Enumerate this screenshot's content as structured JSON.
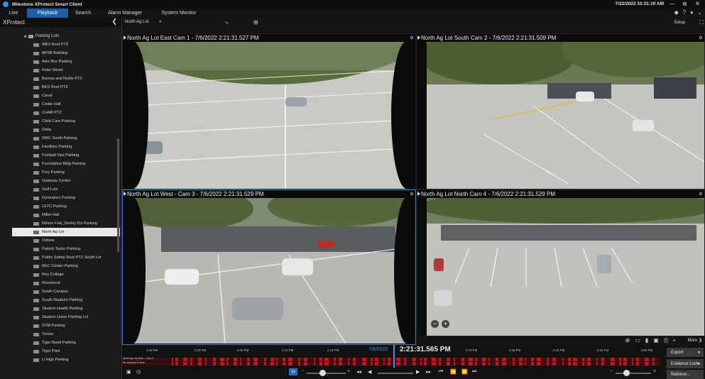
{
  "window": {
    "title": "Milestone XProtect Smart Client",
    "clock": "7/22/2022 10:21:10 AM",
    "buttons": [
      "—",
      "⧉",
      "✕"
    ]
  },
  "menu": {
    "tabs": [
      "Live",
      "Playback",
      "Search",
      "Alarm Manager",
      "System Monitor"
    ],
    "active": "Playback"
  },
  "sidebar": {
    "title": "XProtect",
    "group": "Parking Lots",
    "items": [
      "ABO Roof PTZ",
      "AFSB Building",
      "Alex Box Parking",
      "Aster Street",
      "Barnes and Noble PTZ",
      "BES Roof PTZ",
      "Canal",
      "Cedar Hall",
      "CHAB PTZ",
      "Child Care Parking",
      "Delta",
      "DMC South Parking",
      "Facilities Parking",
      "Football Ops Parking",
      "Foundation Bldg Parking",
      "Frey Parking",
      "Gateway Center",
      "Gulf Lots",
      "Gymnatics Parking",
      "LETC Parking",
      "Miller Hall",
      "Minnie Fisk_Dorthy Dix Parking",
      "North Ag Lot",
      "Oxbow",
      "Patrick Taylor Parking",
      "Public Safety Roof PTZ South Lot",
      "REC Center Parking",
      "Res College",
      "Riverbend",
      "South Campus",
      "South Stadium Parking",
      "Student Health Parking",
      "Student Union Parking Lot",
      "SVM Parking",
      "Tennis",
      "Tiger Band Parking",
      "Tiger Park",
      "U High Parking"
    ],
    "selected": "North Ag Lot"
  },
  "viewbar": {
    "view_name": "North Ag Lot",
    "setup": "Setup"
  },
  "cameras": [
    {
      "title": "North Ag Lot East Cam 1 - 7/6/2022 2:21:31.527 PM"
    },
    {
      "title": "North Ag Lot South Cam 2 - 7/6/2022 2:21:31.509 PM"
    },
    {
      "title": "North Ag Lot West - Cam 3 - 7/6/2022 2:21:31.529 PM"
    },
    {
      "title": "North Ag Lot North Cam 4 - 7/6/2022 2:21:31.529 PM"
    }
  ],
  "camera_toolbar": {
    "more": "More"
  },
  "timeline": {
    "ticks": [
      "1:55 PM",
      "2:00 PM",
      "2:05 PM",
      "2:10 PM",
      "2:15 PM",
      "2:30 PM",
      "2:35 PM",
      "2:40 PM",
      "2:45 PM",
      "2:50 PM"
    ],
    "date": "7/6/2022",
    "current_time": "2:21:31.565 PM",
    "track1_label": "North Ag Lot West - Cam 3",
    "track2_label": "All cameras in view",
    "speed_badge": "1x"
  },
  "actions": {
    "export": "Export",
    "evidence_lock": "Evidence Lock",
    "retrieve": "Retrieve..."
  },
  "colors": {
    "accent": "#1d5fa8",
    "recording": "#b81d1d",
    "selection_border": "#3b7fc4"
  }
}
